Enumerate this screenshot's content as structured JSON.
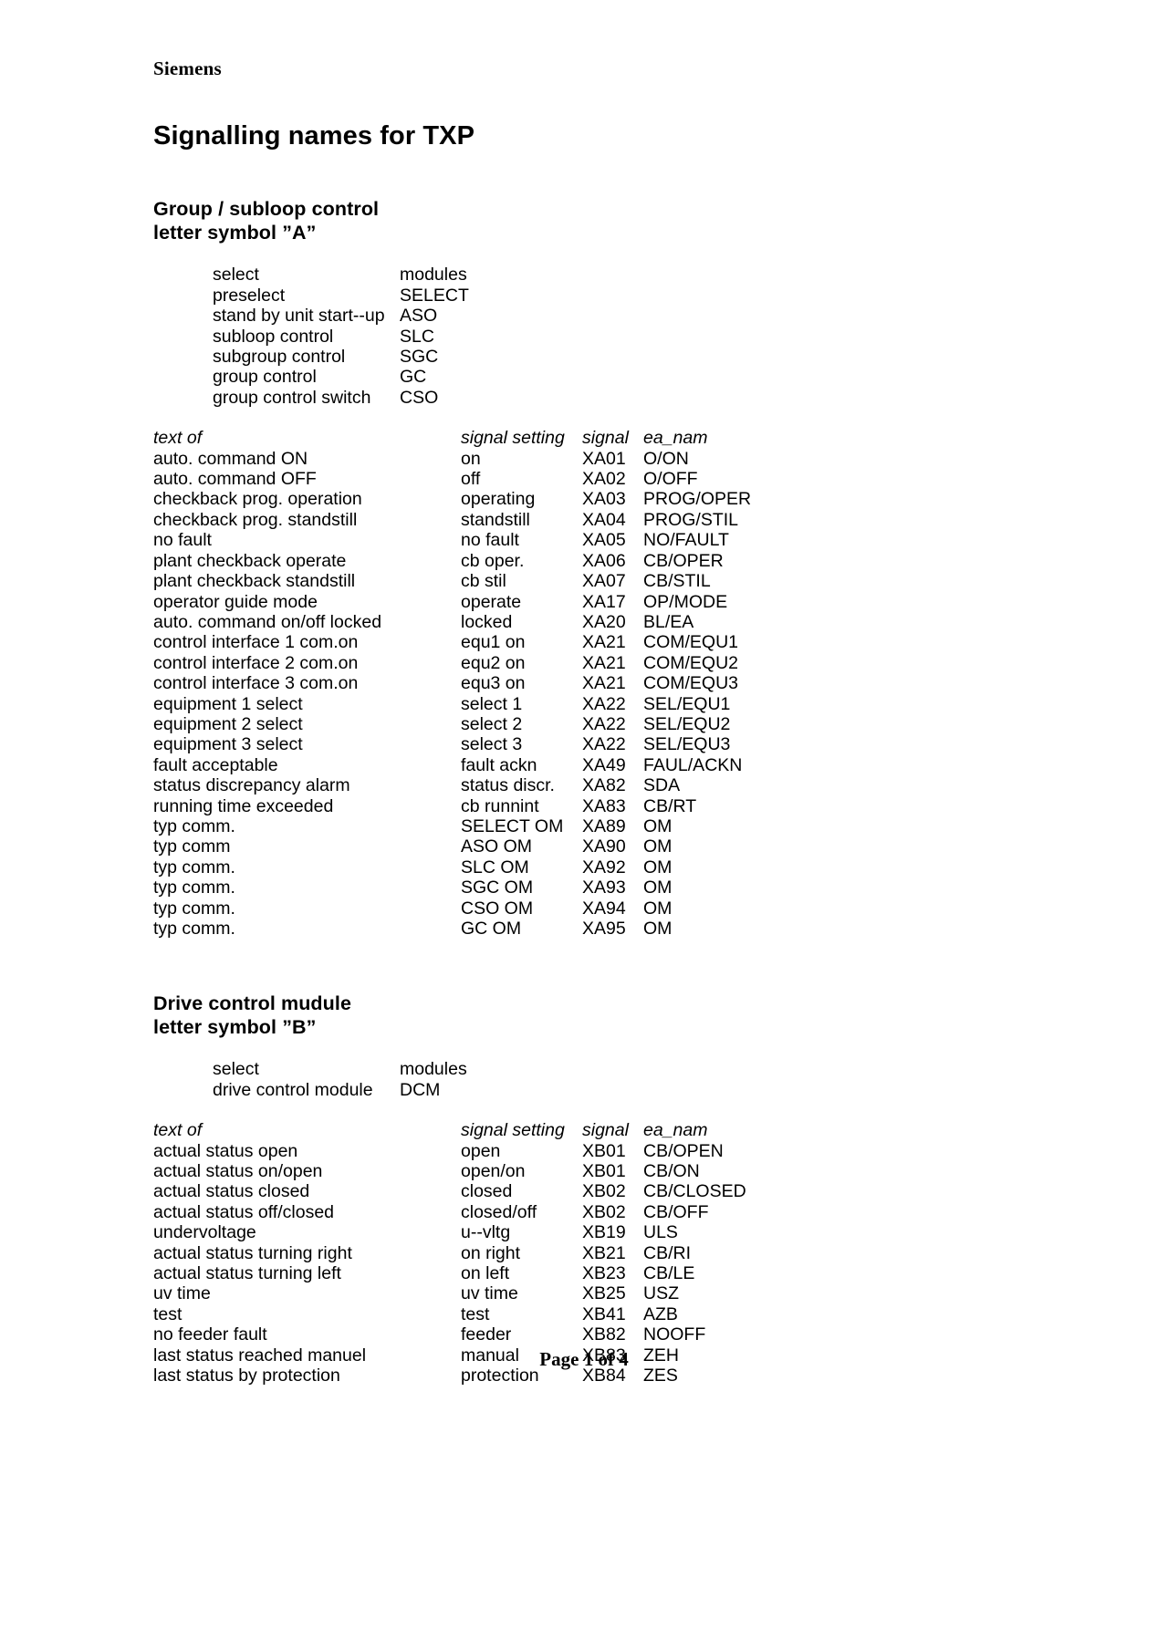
{
  "letterhead": "Siemens",
  "doc_title": "Signalling names for TXP",
  "footer": "Page 1 of 4",
  "table_headers": {
    "text_of": "text of",
    "signal_setting": "signal setting",
    "signal": "signal",
    "ea_nam": "ea_nam"
  },
  "module_headers": {
    "select": "select",
    "modules": "modules"
  },
  "sections": [
    {
      "heading_line1": "Group / subloop control",
      "heading_line2": "letter symbol ”A”",
      "modules": [
        {
          "name": "select",
          "code": "modules"
        },
        {
          "name": "preselect",
          "code": "SELECT"
        },
        {
          "name": "stand by unit start--up",
          "code": "ASO"
        },
        {
          "name": "subloop control",
          "code": "SLC"
        },
        {
          "name": "subgroup control",
          "code": "SGC"
        },
        {
          "name": "group control",
          "code": "GC"
        },
        {
          "name": "group control switch",
          "code": "CSO"
        }
      ],
      "rows": [
        {
          "text": "auto. command ON",
          "setting": "on",
          "signal": "XA01",
          "ea_nam": "O/ON"
        },
        {
          "text": "auto. command OFF",
          "setting": "off",
          "signal": "XA02",
          "ea_nam": "O/OFF"
        },
        {
          "text": "checkback prog. operation",
          "setting": "operating",
          "signal": "XA03",
          "ea_nam": "PROG/OPER"
        },
        {
          "text": "checkback prog. standstill",
          "setting": "standstill",
          "signal": "XA04",
          "ea_nam": "PROG/STIL"
        },
        {
          "text": "no fault",
          "setting": "no fault",
          "signal": "XA05",
          "ea_nam": "NO/FAULT"
        },
        {
          "text": "plant checkback operate",
          "setting": "cb oper.",
          "signal": "XA06",
          "ea_nam": "CB/OPER"
        },
        {
          "text": "plant checkback standstill",
          "setting": "cb stil",
          "signal": "XA07",
          "ea_nam": "CB/STIL"
        },
        {
          "text": "operator guide mode",
          "setting": "operate",
          "signal": "XA17",
          "ea_nam": "OP/MODE"
        },
        {
          "text": "auto. command on/off locked",
          "setting": "locked",
          "signal": "XA20",
          "ea_nam": "BL/EA"
        },
        {
          "text": "control interface 1 com.on",
          "setting": "equ1 on",
          "signal": "XA21",
          "ea_nam": "COM/EQU1"
        },
        {
          "text": "control interface 2 com.on",
          "setting": "equ2 on",
          "signal": "XA21",
          "ea_nam": "COM/EQU2"
        },
        {
          "text": "control interface 3 com.on",
          "setting": "equ3 on",
          "signal": "XA21",
          "ea_nam": "COM/EQU3"
        },
        {
          "text": "equipment 1 select",
          "setting": "select 1",
          "signal": "XA22",
          "ea_nam": "SEL/EQU1"
        },
        {
          "text": "equipment 2 select",
          "setting": "select 2",
          "signal": "XA22",
          "ea_nam": "SEL/EQU2"
        },
        {
          "text": "equipment 3 select",
          "setting": "select 3",
          "signal": "XA22",
          "ea_nam": "SEL/EQU3"
        },
        {
          "text": "fault acceptable",
          "setting": "fault ackn",
          "signal": "XA49",
          "ea_nam": "FAUL/ACKN"
        },
        {
          "text": "status discrepancy alarm",
          "setting": "status discr.",
          "signal": "XA82",
          "ea_nam": "SDA"
        },
        {
          "text": "running time exceeded",
          "setting": "cb runnint",
          "signal": "XA83",
          "ea_nam": "CB/RT"
        },
        {
          "text": "typ comm.",
          "setting": "SELECT OM",
          "signal": "XA89",
          "ea_nam": "OM"
        },
        {
          "text": "typ comm",
          "setting": "ASO OM",
          "signal": "XA90",
          "ea_nam": "OM"
        },
        {
          "text": "typ comm.",
          "setting": "SLC OM",
          "signal": "XA92",
          "ea_nam": "OM"
        },
        {
          "text": "typ comm.",
          "setting": "SGC OM",
          "signal": "XA93",
          "ea_nam": "OM"
        },
        {
          "text": "typ comm.",
          "setting": "CSO OM",
          "signal": "XA94",
          "ea_nam": "OM"
        },
        {
          "text": "typ comm.",
          "setting": "GC OM",
          "signal": "XA95",
          "ea_nam": "OM"
        }
      ]
    },
    {
      "heading_line1": "Drive control mudule",
      "heading_line2": "letter symbol ”B”",
      "modules": [
        {
          "name": "select",
          "code": "modules"
        },
        {
          "name": "drive control module",
          "code": "DCM"
        }
      ],
      "rows": [
        {
          "text": "actual status open",
          "setting": "open",
          "signal": "XB01",
          "ea_nam": "CB/OPEN"
        },
        {
          "text": "actual status on/open",
          "setting": "open/on",
          "signal": "XB01",
          "ea_nam": "CB/ON"
        },
        {
          "text": "actual status closed",
          "setting": "closed",
          "signal": "XB02",
          "ea_nam": "CB/CLOSED"
        },
        {
          "text": "actual status off/closed",
          "setting": "closed/off",
          "signal": "XB02",
          "ea_nam": "CB/OFF"
        },
        {
          "text": "undervoltage",
          "setting": "u--vltg",
          "signal": "XB19",
          "ea_nam": "ULS"
        },
        {
          "text": "actual status turning right",
          "setting": "on right",
          "signal": "XB21",
          "ea_nam": "CB/RI"
        },
        {
          "text": "actual status turning left",
          "setting": "on left",
          "signal": "XB23",
          "ea_nam": "CB/LE"
        },
        {
          "text": "uv time",
          "setting": "uv time",
          "signal": "XB25",
          "ea_nam": "USZ"
        },
        {
          "text": "test",
          "setting": "test",
          "signal": "XB41",
          "ea_nam": "AZB"
        },
        {
          "text": "no feeder fault",
          "setting": "feeder",
          "signal": "XB82",
          "ea_nam": "NOOFF"
        },
        {
          "text": "last status reached manuel",
          "setting": "manual",
          "signal": "XB83",
          "ea_nam": "ZEH"
        },
        {
          "text": "last status by protection",
          "setting": "protection",
          "signal": "XB84",
          "ea_nam": "ZES"
        }
      ]
    }
  ]
}
